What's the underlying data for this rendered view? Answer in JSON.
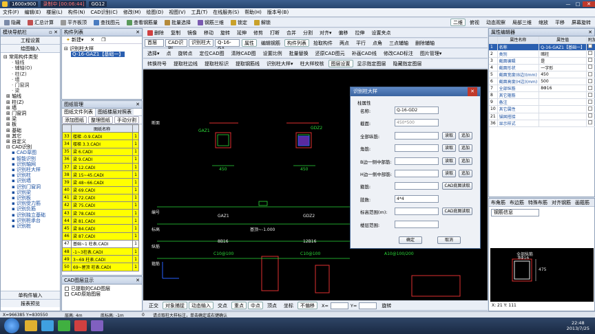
{
  "window": {
    "title_fragments": [
      "1600x900",
      "录制中 [00:06:44]",
      "GG12"
    ],
    "control_min": "—",
    "control_max": "□",
    "control_close": "✕"
  },
  "menu": [
    "文件(F)",
    "编辑(E)",
    "楼层(L)",
    "构件(N)",
    "CAD识别(C)",
    "修改(M)",
    "绘图(D)",
    "视图(V)",
    "工具(T)",
    "在线服务(S)",
    "帮助(H)",
    "版本号(B)"
  ],
  "toolbar1": [
    "隐藏",
    "汇总计算",
    "平齐板顶",
    "查找图元",
    "查看钢筋量",
    "批量选择",
    "钢筋三维",
    "锁定",
    "解锁"
  ],
  "toolbar1_right": [
    "二维",
    "俯视",
    "动态观察",
    "局部三维",
    "缩放",
    "平移",
    "屏幕旋转"
  ],
  "toolbar2": [
    "删除",
    "复制",
    "镜像",
    "移动",
    "旋转",
    "延伸",
    "修剪",
    "打断",
    "合并",
    "分割",
    "对齐",
    "偏移",
    "拉伸",
    "设置夹点"
  ],
  "toolbar3": {
    "floor": "首层",
    "layer": "CAD识别",
    "type": "识别柱大",
    "element": "Q-16-GA",
    "buttons": [
      "属性",
      "编辑钢筋",
      "构件列表",
      "拾取构件"
    ],
    "right": [
      "两点",
      "平行",
      "点角",
      "三点辅轴",
      "删除辅轴"
    ]
  },
  "toolbar4": [
    "选择",
    "点",
    "旋转点",
    "定位CAD图",
    "清除CAD图",
    "设置比例",
    "批量替换",
    "还原CAD图元",
    "补画CAD线",
    "修改CAD标注",
    "图片管理"
  ],
  "toolbar5": [
    "转换符号",
    "提取柱边线",
    "提取柱标识",
    "提取钢筋线",
    "识别柱大样",
    "柱大样校核",
    "图层设置",
    "显示指定图层",
    "隐藏指定图层"
  ],
  "left_nav": {
    "title": "模块导航栏",
    "tabs": [
      "工程设置",
      "绘图输入"
    ],
    "tree": [
      "常用构件类型",
      "轴线",
      "辅轴(O)",
      "柱(Z)",
      "墙",
      "门窗洞",
      "梁",
      "板",
      "基础",
      "其它",
      "自定义",
      "CAD识别",
      "CAD草图",
      "智能识别",
      "识别轴网",
      "识别柱大样",
      "识别柱",
      "识别墙",
      "识别门窗洞",
      "识别梁",
      "识别板",
      "识别受力筋",
      "识别负筋",
      "识别独立基础",
      "识别桩承台",
      "识别桩"
    ],
    "bottom": [
      "单构件输入",
      "报表预览"
    ]
  },
  "component_list": {
    "title": "构件列表",
    "new_label": "新建",
    "root": "识别柱大样",
    "selected": "Q-16-GAZ1【基础一】"
  },
  "drawing_mgmt": {
    "title": "图纸管理",
    "tabs": [
      "图纸文件列表",
      "图纸楼层对照表"
    ],
    "buttons": [
      "添加图纸",
      "整理图纸",
      "手动分割"
    ],
    "header": "图纸名称",
    "rows": [
      {
        "no": "33",
        "name": "楼梯 -0.9.CADI",
        "v": "1",
        "hl": true
      },
      {
        "no": "34",
        "name": "楼梯 3.3.CADI",
        "v": "1",
        "hl": true
      },
      {
        "no": "35",
        "name": "梁 6.CADI",
        "v": "1",
        "hl": true
      },
      {
        "no": "36",
        "name": "梁 9.CADI",
        "v": "1",
        "hl": true
      },
      {
        "no": "37",
        "name": "梁 12.CADI",
        "v": "1",
        "hl": true
      },
      {
        "no": "38",
        "name": "梁 15~45.CADI",
        "v": "1",
        "hl": true
      },
      {
        "no": "39",
        "name": "梁 48~66.CADI",
        "v": "1",
        "hl": true
      },
      {
        "no": "40",
        "name": "梁 69.CADI",
        "v": "1",
        "hl": true
      },
      {
        "no": "41",
        "name": "梁 72.CADI",
        "v": "1",
        "hl": true
      },
      {
        "no": "42",
        "name": "梁 75.CADI",
        "v": "1",
        "hl": true
      },
      {
        "no": "43",
        "name": "梁 78.CADI",
        "v": "1",
        "hl": true
      },
      {
        "no": "44",
        "name": "梁 81.CADI",
        "v": "1",
        "hl": true
      },
      {
        "no": "45",
        "name": "梁 84.CADI",
        "v": "1",
        "hl": true
      },
      {
        "no": "46",
        "name": "梁 87.CADI",
        "v": "1",
        "hl": true
      },
      {
        "no": "47",
        "name": "基础~1 柱表.CADI",
        "v": "1",
        "hl": false
      },
      {
        "no": "48",
        "name": "-1~3柱表.CADI",
        "v": "1",
        "hl": true
      },
      {
        "no": "49",
        "name": "3~69 柱表.CADI",
        "v": "1",
        "hl": true
      },
      {
        "no": "50",
        "name": "69~屋顶 柱表.CADI",
        "v": "1",
        "hl": true
      }
    ]
  },
  "cad_display": {
    "title": "CAD图层显示",
    "items": [
      "已提取的CAD图层",
      "CAD原始图层"
    ]
  },
  "cad_canvas": {
    "labels_white": [
      "编号",
      "标高",
      "纵筋",
      "箍筋",
      "断面"
    ],
    "col_ids": [
      "GAZ1",
      "GDZ2"
    ],
    "col_ids_small": [
      "GAZ1",
      "GDZ2"
    ],
    "dims": [
      "450",
      "450",
      "450",
      "450"
    ],
    "elev": "基顶~-1.000",
    "rebar": [
      "8B16",
      "12B16"
    ],
    "stirrup": [
      "C10@100",
      "C10@100",
      "A10@100/200"
    ]
  },
  "dialog": {
    "title": "识别柱大样",
    "group": "柱属性",
    "fields": [
      {
        "label": "名称:",
        "value": "Q-16-GD2",
        "btns": []
      },
      {
        "label": "截面:",
        "value": "450*500",
        "btns": []
      },
      {
        "label": "全部纵筋:",
        "value": "",
        "btns": [
          "读取",
          "追加"
        ]
      },
      {
        "label": "角筋:",
        "value": "",
        "btns": [
          "读取",
          "追加"
        ]
      },
      {
        "label": "B边一侧中部筋:",
        "value": "",
        "btns": [
          "读取",
          "追加"
        ]
      },
      {
        "label": "H边一侧中部筋:",
        "value": "",
        "btns": [
          "读取",
          "追加"
        ]
      },
      {
        "label": "箍筋:",
        "value": "",
        "btns": [
          "CAD底图读取"
        ]
      },
      {
        "label": "肢数:",
        "value": "4*4",
        "btns": []
      },
      {
        "label": "标高范围(m):",
        "value": "",
        "btns": [
          "CAD底图读取"
        ]
      },
      {
        "label": "楼层范围:",
        "value": "",
        "btns": []
      }
    ],
    "ok": "确定",
    "cancel": "取消"
  },
  "props": {
    "title": "属性编辑器",
    "headers": [
      "属性名称",
      "属性值",
      "附加"
    ],
    "rows": [
      {
        "no": "1",
        "name": "名称",
        "value": "Q-16-GAZ1【基础一】",
        "sel": true
      },
      {
        "no": "2",
        "name": "类别",
        "value": "暗柱",
        "sel": false
      },
      {
        "no": "3",
        "name": "截面编辑",
        "value": "是",
        "sel": false
      },
      {
        "no": "4",
        "name": "截面形状",
        "value": "一字形",
        "sel": false
      },
      {
        "no": "5",
        "name": "截面宽度(B边)(mm)",
        "value": "450",
        "sel": false
      },
      {
        "no": "6",
        "name": "截面高度(H边)(mm)",
        "value": "500",
        "sel": false
      },
      {
        "no": "7",
        "name": "全部纵筋",
        "value": "8Φ16",
        "sel": false
      },
      {
        "no": "8",
        "name": "其它箍筋",
        "value": "",
        "sel": false
      },
      {
        "no": "9",
        "name": "备注",
        "value": "",
        "sel": false
      },
      {
        "no": "10",
        "name": "其它属性",
        "value": "",
        "sel": false
      },
      {
        "no": "21",
        "name": "锚固搭接",
        "value": "",
        "sel": false
      },
      {
        "no": "36",
        "name": "显示样式",
        "value": "",
        "sel": false
      }
    ],
    "lower_tabs": [
      "布角筋",
      "布边筋",
      "特殊布筋",
      "对齐钢筋",
      "画箍筋"
    ],
    "lower_select": "钢筋信息",
    "preview_labels": [
      "全部纵筋",
      "8Φ16"
    ],
    "preview_dim": "475",
    "coords": "X: 21 Y: 111"
  },
  "snapbar": [
    "正交",
    "对象捕捉",
    "动态输入",
    "交点",
    "重点",
    "中点",
    "顶点",
    "坐标",
    "不偏移",
    "旋转"
  ],
  "snap_xy": [
    "X=",
    "Y="
  ],
  "status": {
    "xy": "X=966385  Y=830550",
    "floor": "层高: 4m",
    "base": "底标高: -1m",
    "zero": "0",
    "hint": "请点取柱大样标注，单击确定或右键确认",
    "date": "2013/7/25",
    "time": "22:48"
  },
  "colors": {
    "yellow_row": "#ffff00",
    "selected_row": "#2a5fb0",
    "cad_red": "#e03030",
    "cad_green": "#2ddd3a"
  }
}
